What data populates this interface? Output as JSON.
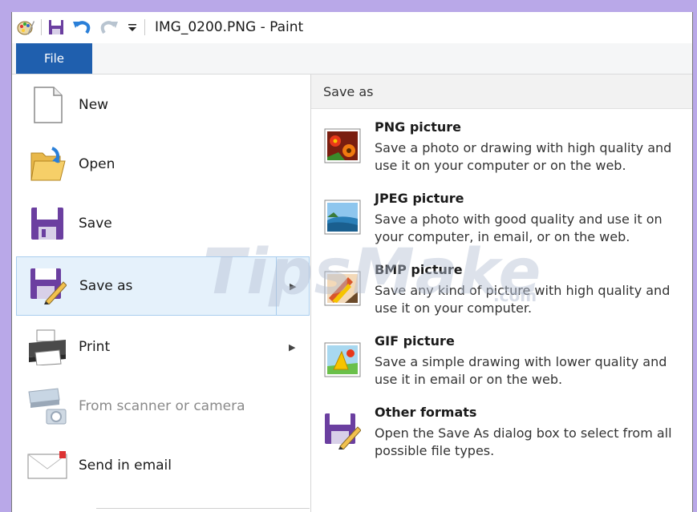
{
  "window": {
    "title": "IMG_0200.PNG - Paint"
  },
  "ribbon": {
    "file_tab": "File"
  },
  "menu": {
    "items": [
      {
        "label": "New"
      },
      {
        "label": "Open"
      },
      {
        "label": "Save"
      },
      {
        "label": "Save as"
      },
      {
        "label": "Print"
      },
      {
        "label": "From scanner or camera"
      },
      {
        "label": "Send in email"
      }
    ]
  },
  "save_as": {
    "heading": "Save as",
    "formats": [
      {
        "title": "PNG picture",
        "desc": "Save a photo or drawing with high quality and use it on your computer or on the web."
      },
      {
        "title": "JPEG picture",
        "desc": "Save a photo with good quality and use it on your computer, in email, or on the web."
      },
      {
        "title": "BMP picture",
        "desc": "Save any kind of picture with high quality and use it on your computer."
      },
      {
        "title": "GIF picture",
        "desc": "Save a simple drawing with lower quality and use it in email or on the web."
      },
      {
        "title": "Other formats",
        "desc": "Open the Save As dialog box to select from all possible file types."
      }
    ]
  },
  "watermark": {
    "main": "TipsMake",
    "suffix": ".com"
  },
  "colors": {
    "accent": "#1f5fae",
    "selection": "#e5f1fb",
    "frame": "#b9a8e8"
  }
}
